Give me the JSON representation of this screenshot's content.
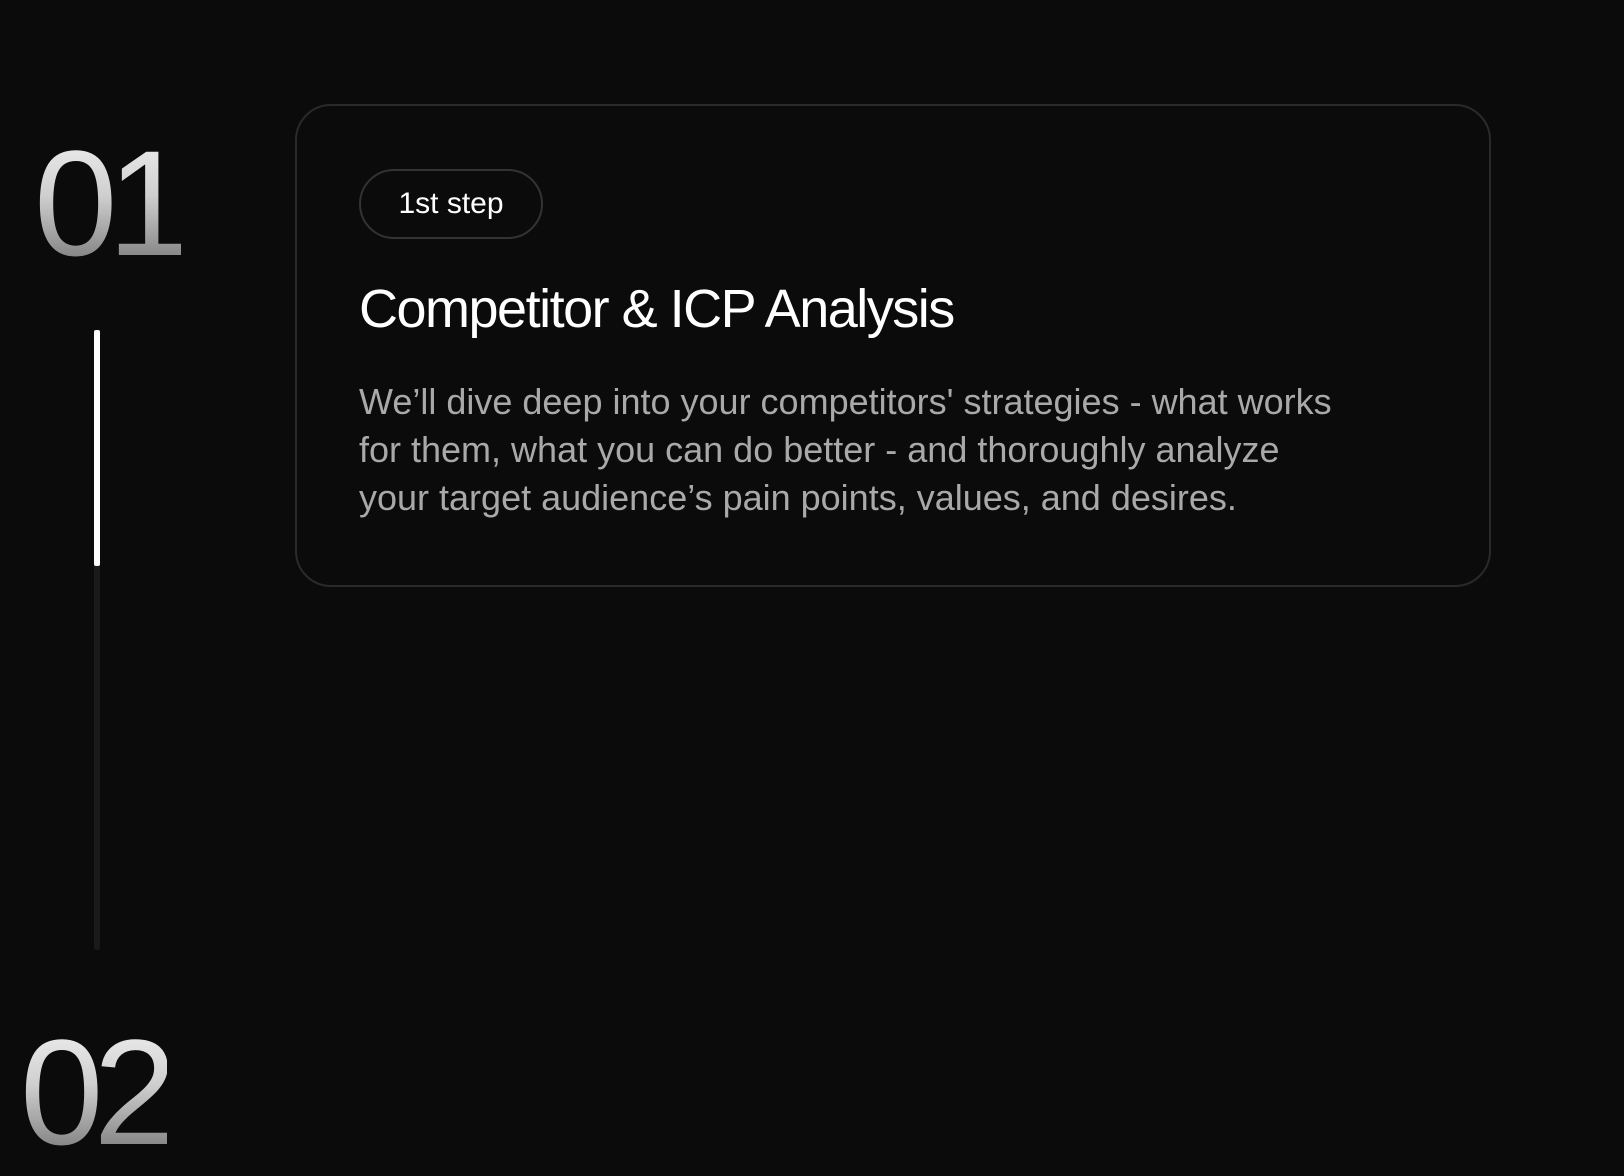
{
  "steps": [
    {
      "number": "01",
      "badge": "1st step",
      "title": "Competitor & ICP Analysis",
      "description": "We’ll dive deep into your competitors' strategies - what works\nfor them, what you can do better -  and thoroughly analyze\nyour target audience’s pain points, values, and desires."
    },
    {
      "number": "02"
    }
  ],
  "progress": {
    "fraction": 0.38,
    "track_color": "#1a1a1a",
    "fill_color": "#ffffff"
  },
  "colors": {
    "background": "#0b0b0b",
    "card_border": "#2a2a2a",
    "title": "#ffffff",
    "description": "#a9a9a9"
  }
}
